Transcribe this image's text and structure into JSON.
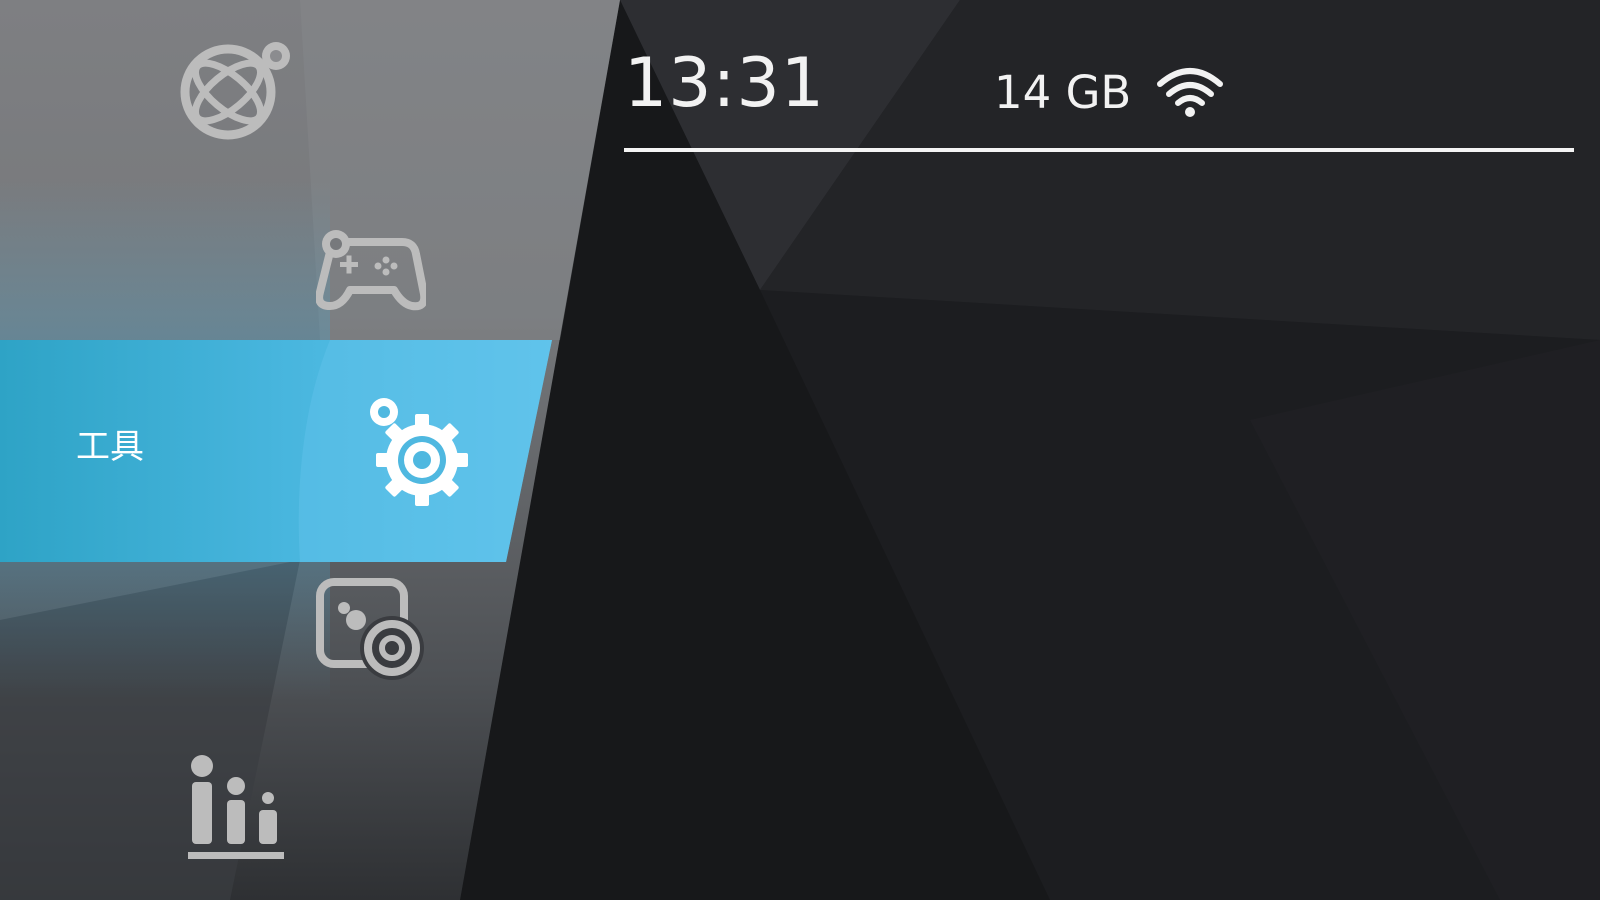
{
  "status_bar": {
    "clock": "13:31",
    "storage": "14 GB",
    "wifi_icon": "wifi-icon"
  },
  "menu": {
    "selected_label": "工具",
    "items": [
      {
        "icon": "online-globe-icon"
      },
      {
        "icon": "gamepad-icon"
      },
      {
        "icon": "settings-gear-icon",
        "selected": true
      },
      {
        "icon": "media-photo-music-icon"
      },
      {
        "icon": "stats-bars-icon"
      }
    ]
  },
  "colors": {
    "accent": "#5cc0e8",
    "icon": "#b9b9b9",
    "background": "#1d1e21"
  }
}
